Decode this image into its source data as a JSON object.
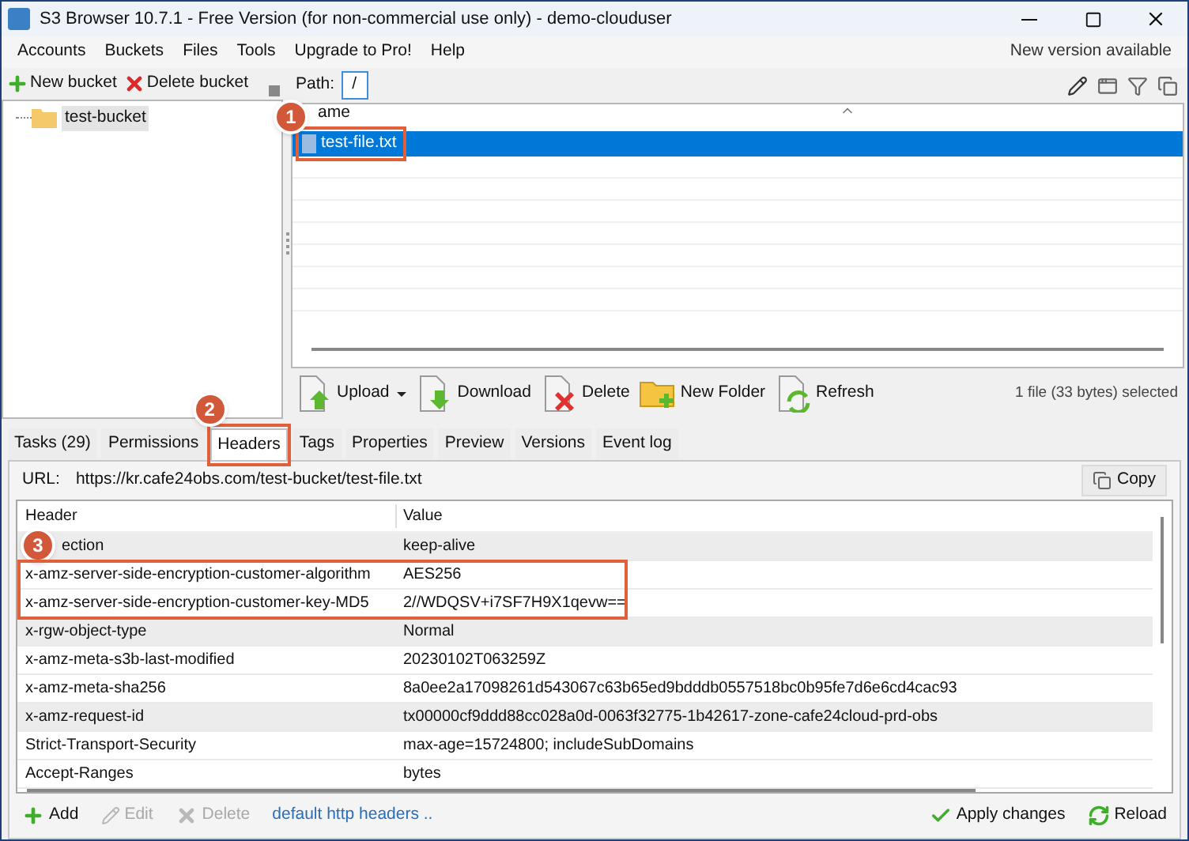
{
  "window": {
    "title": "S3 Browser 10.7.1 - Free Version (for non-commercial use only) - demo-clouduser"
  },
  "menu": [
    {
      "label": "Accounts"
    },
    {
      "label": "Buckets"
    },
    {
      "label": "Files"
    },
    {
      "label": "Tools"
    },
    {
      "label": "Upgrade to Pro!"
    },
    {
      "label": "Help"
    }
  ],
  "notice": "New version available",
  "bucket_toolbar": [
    {
      "label": "New bucket",
      "kind": "add"
    },
    {
      "label": "Delete bucket",
      "kind": "delete"
    }
  ],
  "buckets": [
    {
      "name": "test-bucket",
      "selected": true
    }
  ],
  "path": {
    "label": "Path:",
    "value": "/"
  },
  "file_list": {
    "columns": [
      "ame"
    ],
    "rows": [
      {
        "name": "test-file.txt",
        "selected": true
      }
    ]
  },
  "file_toolbar": [
    {
      "label": "Upload",
      "kind": "upload",
      "dropdown": true
    },
    {
      "label": "Download",
      "kind": "download",
      "dropdown": false
    },
    {
      "label": "Delete",
      "kind": "delete",
      "dropdown": false
    },
    {
      "label": "New Folder",
      "kind": "folder",
      "dropdown": false
    },
    {
      "label": "Refresh",
      "kind": "refresh",
      "dropdown": false
    }
  ],
  "selection_status": "1 file (33 bytes) selected",
  "tabs": [
    {
      "label": "Tasks (29)",
      "selected": false
    },
    {
      "label": "Permissions",
      "selected": false
    },
    {
      "label": "Headers",
      "selected": true
    },
    {
      "label": "Tags",
      "selected": false
    },
    {
      "label": "Properties",
      "selected": false
    },
    {
      "label": "Preview",
      "selected": false
    },
    {
      "label": "Versions",
      "selected": false
    },
    {
      "label": "Event log",
      "selected": false
    }
  ],
  "url": {
    "label": "URL:",
    "value": "https://kr.cafe24obs.com/test-bucket/test-file.txt"
  },
  "copy_button": "Copy",
  "headers_table": {
    "columns": [
      "Header",
      "Value"
    ],
    "rows": [
      {
        "header": "ection",
        "value": "keep-alive"
      },
      {
        "header": "x-amz-server-side-encryption-customer-algorithm",
        "value": "AES256"
      },
      {
        "header": "x-amz-server-side-encryption-customer-key-MD5",
        "value": "2//WDQSV+i7SF7H9X1qevw=="
      },
      {
        "header": "x-rgw-object-type",
        "value": "Normal"
      },
      {
        "header": "x-amz-meta-s3b-last-modified",
        "value": "20230102T063259Z"
      },
      {
        "header": "x-amz-meta-sha256",
        "value": "8a0ee2a17098261d543067c63b65ed9bdddb0557518bc0b95fe7d6e6cd4cac93"
      },
      {
        "header": "x-amz-request-id",
        "value": "tx00000cf9ddd88cc028a0d-0063f32775-1b42617-zone-cafe24cloud-prd-obs"
      },
      {
        "header": "Strict-Transport-Security",
        "value": "max-age=15724800; includeSubDomains"
      },
      {
        "header": "Accept-Ranges",
        "value": "bytes"
      }
    ]
  },
  "bottom_toolbar": [
    {
      "label": "Add",
      "kind": "add",
      "disabled": false
    },
    {
      "label": "Edit",
      "kind": "edit",
      "disabled": true
    },
    {
      "label": "Delete",
      "kind": "delete",
      "disabled": true
    }
  ],
  "link": "default http headers ..",
  "actions": [
    {
      "label": "Apply changes",
      "kind": "apply"
    },
    {
      "label": "Reload",
      "kind": "reload"
    }
  ],
  "annotations": [
    {
      "label": "1"
    },
    {
      "label": "2"
    },
    {
      "label": "3"
    }
  ]
}
